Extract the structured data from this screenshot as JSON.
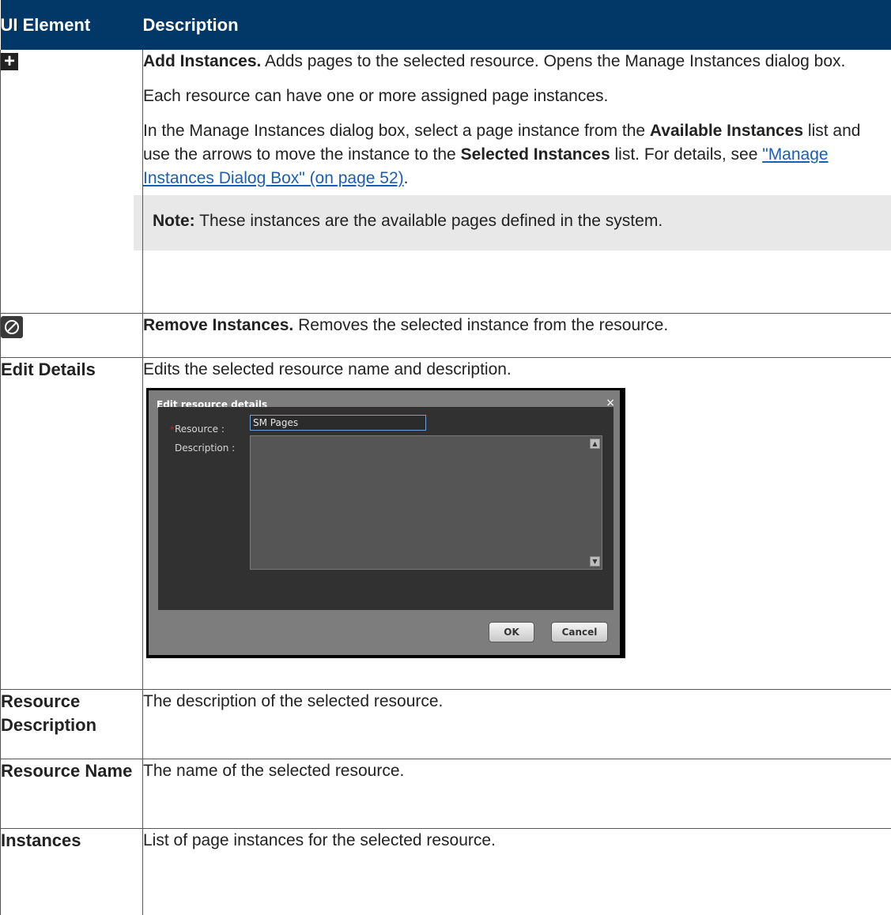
{
  "header": {
    "col1": "UI Element",
    "col2": "Description"
  },
  "rows": {
    "add": {
      "icon": "plus-icon",
      "title": "Add Instances.",
      "text": " Adds pages to the selected resource. Opens the Manage Instances dialog box.",
      "p2": "Each resource can have one or more assigned page instances.",
      "p3_a": "In the Manage Instances dialog box, select a page instance from the ",
      "p3_b": "Available Instances",
      "p3_c": " list and use the arrows to move the instance to the ",
      "p3_d": "Selected Instances",
      "p3_e": " list. For details, see ",
      "p3_link": "\"Manage Instances Dialog Box\" (on page 52)",
      "p3_f": ".",
      "note_label": "Note:",
      "note_text": " These instances are the available pages defined in the system."
    },
    "remove": {
      "icon": "remove-circle-icon",
      "title": "Remove Instances.",
      "text": " Removes the selected instance from the resource."
    },
    "edit": {
      "label": "Edit Details",
      "text": "Edits the selected resource name and description.",
      "dialog": {
        "title": "Edit resource details",
        "close": "×",
        "required_mark": "*",
        "resource_label": "Resource :",
        "resource_value": "SM Pages",
        "description_label": "Description :",
        "ok": "OK",
        "cancel": "Cancel"
      }
    },
    "resdesc": {
      "label": "Resource Description",
      "text": "The description of the selected resource."
    },
    "resname": {
      "label": "Resource Name",
      "text": "The name of the selected resource."
    },
    "instances": {
      "label": "Instances",
      "text": "List of page instances for the selected resource."
    }
  }
}
